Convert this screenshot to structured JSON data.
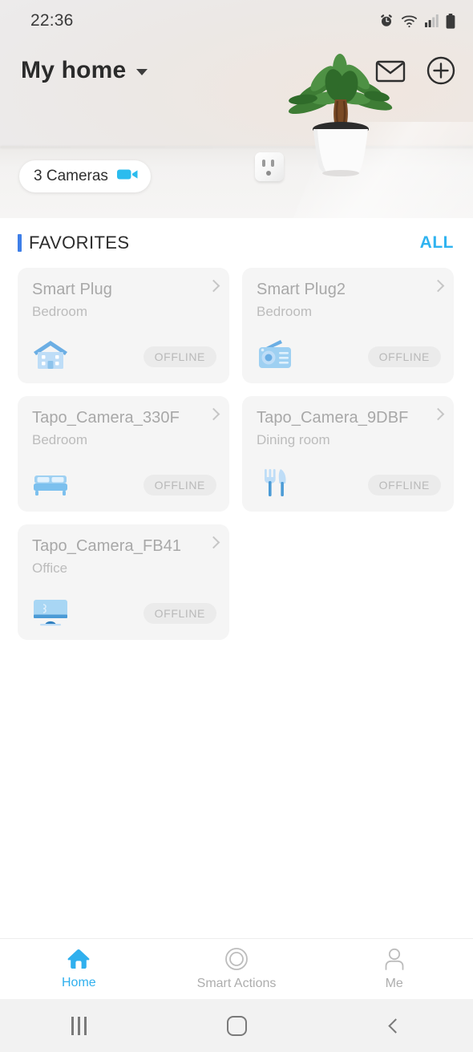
{
  "status_bar": {
    "time": "22:36",
    "icons": [
      "alarm-icon",
      "wifi-icon",
      "cellular-signal-icon",
      "battery-icon"
    ]
  },
  "header": {
    "home_name": "My home",
    "dropdown_icon": "chevron-down-icon",
    "mail_icon": "mail-icon",
    "add_icon": "plus-circle-icon"
  },
  "camera_pill": {
    "label": "3 Cameras",
    "icon": "camcorder-icon",
    "icon_color": "#2BBCEE"
  },
  "section": {
    "title": "FAVORITES",
    "all_label": "ALL",
    "accent_color": "#3E7FE8",
    "all_color": "#2FB3F0"
  },
  "devices": [
    {
      "name": "Smart Plug",
      "room": "Bedroom",
      "status": "OFFLINE",
      "icon": "house-icon"
    },
    {
      "name": "Smart Plug2",
      "room": "Bedroom",
      "status": "OFFLINE",
      "icon": "radio-icon"
    },
    {
      "name": "Tapo_Camera_330F",
      "room": "Bedroom",
      "status": "OFFLINE",
      "icon": "bed-icon"
    },
    {
      "name": "Tapo_Camera_9DBF",
      "room": "Dining room",
      "status": "OFFLINE",
      "icon": "cutlery-icon"
    },
    {
      "name": "Tapo_Camera_FB41",
      "room": "Office",
      "status": "OFFLINE",
      "icon": "monitor-icon"
    }
  ],
  "bottom_nav": {
    "active_color": "#30B0EE",
    "items": [
      {
        "label": "Home",
        "icon": "home-icon",
        "active": true
      },
      {
        "label": "Smart Actions",
        "icon": "circle-target-icon",
        "active": false
      },
      {
        "label": "Me",
        "icon": "person-icon",
        "active": false
      }
    ]
  },
  "system_bar": {
    "recents": "recents-icon",
    "home": "home-square-icon",
    "back": "back-chevron-icon"
  }
}
